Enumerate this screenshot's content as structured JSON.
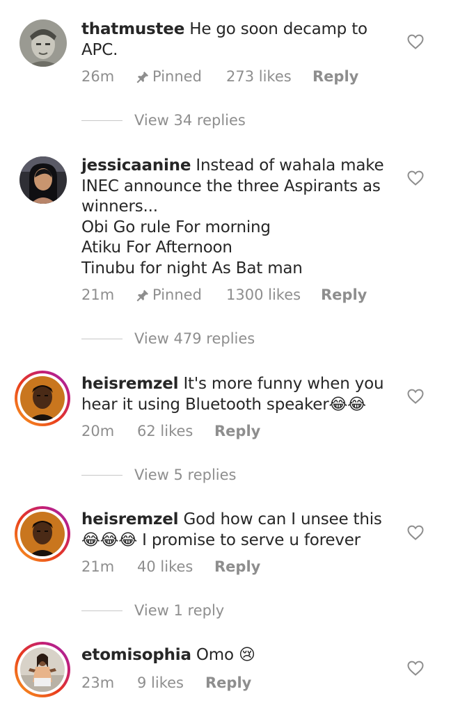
{
  "comments": [
    {
      "username": "thatmustee",
      "text": "He go soon decamp to APC.",
      "time": "26m",
      "pinned": "Pinned",
      "likes": "273 likes",
      "reply": "Reply",
      "view_replies": "View 34 replies"
    },
    {
      "username": "jessicaanine",
      "text_lines": [
        "Instead of wahala make INEC announce the three Aspirants as winners...",
        "Obi Go rule For morning",
        "Atiku For Afternoon",
        "Tinubu for night As Bat man"
      ],
      "time": "21m",
      "pinned": "Pinned",
      "likes": "1300 likes",
      "reply": "Reply",
      "view_replies": "View 479 replies"
    },
    {
      "username": "heisremzel",
      "text": "It's more funny when you hear it using Bluetooth speaker😂😂",
      "time": "20m",
      "likes": "62 likes",
      "reply": "Reply",
      "view_replies": "View 5 replies"
    },
    {
      "username": "heisremzel",
      "text": "God how can I unsee this 😂😂😂 I promise to serve u forever",
      "time": "21m",
      "likes": "40 likes",
      "reply": "Reply",
      "view_replies": "View 1 reply"
    },
    {
      "username": "etomisophia",
      "text": "Omo 😢",
      "time": "23m",
      "likes": "9 likes",
      "reply": "Reply"
    }
  ],
  "icons": {
    "pin": "pin-icon",
    "heart": "heart-outline-icon"
  },
  "colors": {
    "text": "#262626",
    "secondary": "#8e8e8e",
    "story_ring_start": "#f9a11f",
    "story_ring_end": "#c21e76"
  }
}
